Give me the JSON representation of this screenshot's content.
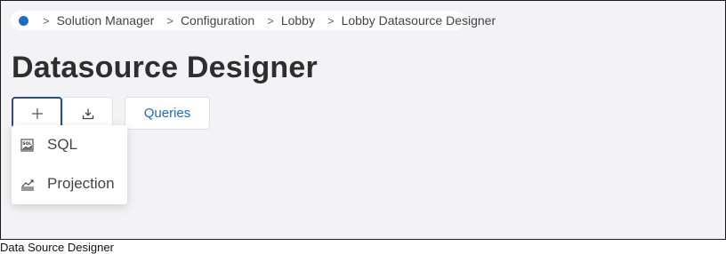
{
  "breadcrumb": {
    "home_icon": "home-dot-icon",
    "items": [
      "Solution Manager",
      "Configuration",
      "Lobby",
      "Lobby Datasource Designer"
    ]
  },
  "page": {
    "title": "Datasource Designer"
  },
  "toolbar": {
    "add_icon": "plus-icon",
    "export_icon": "download-icon",
    "queries_label": "Queries"
  },
  "add_menu": {
    "items": [
      {
        "icon": "sql-icon",
        "label": "SQL"
      },
      {
        "icon": "projection-icon",
        "label": "Projection"
      }
    ]
  },
  "caption": "Data Source Designer",
  "colors": {
    "accent": "#1d6bc3",
    "background": "#f3f2f4",
    "focus_border": "#2b4f7e"
  }
}
